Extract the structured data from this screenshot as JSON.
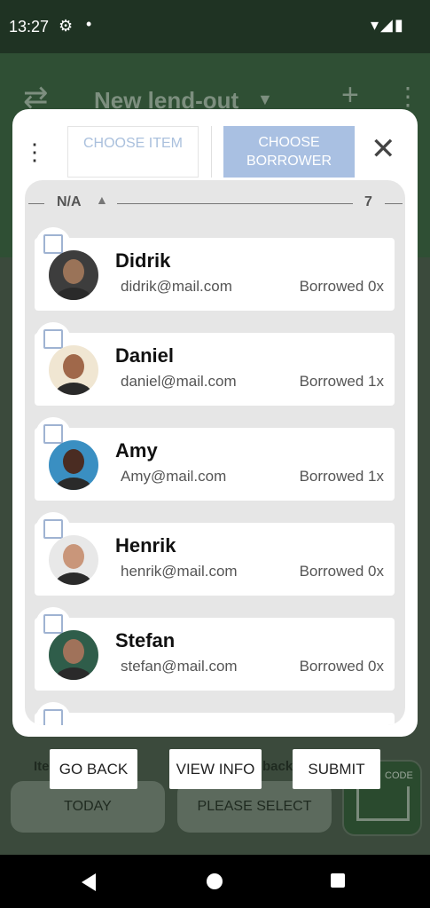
{
  "status": {
    "time": "13:27",
    "gear_icon": "⚙",
    "dot": "•",
    "sys_icons": "▾◢▮"
  },
  "appbar": {
    "title": "New lend-out",
    "dropdown_glyph": "▼",
    "add_glyph": "+",
    "more_glyph": "⋮",
    "logo_glyph": "⇄"
  },
  "underlying": {
    "item_label": "Ite",
    "feedback_label": "back",
    "today_button": "TODAY",
    "please_select_button": "PLEASE SELECT",
    "scan_code_label": "CODE"
  },
  "modal": {
    "menu_glyph": "⋮",
    "tab_choose_item": "CHOOSE ITEM",
    "tab_choose_borrower": "CHOOSE BORROWER",
    "close_glyph": "✕",
    "group": {
      "label": "N/A",
      "caret": "▲",
      "count": "7"
    },
    "borrowers": [
      {
        "name": "Didrik",
        "email": "didrik@mail.com",
        "borrowed": "Borrowed 0x",
        "avatar_bg": "#3d3d3d",
        "avatar_face": "#9a7358"
      },
      {
        "name": "Daniel",
        "email": "daniel@mail.com",
        "borrowed": "Borrowed 1x",
        "avatar_bg": "#f0e6d2",
        "avatar_face": "#a0684a"
      },
      {
        "name": "Amy",
        "email": "Amy@mail.com",
        "borrowed": "Borrowed 1x",
        "avatar_bg": "#3a8fc2",
        "avatar_face": "#4a2c22"
      },
      {
        "name": "Henrik",
        "email": "henrik@mail.com",
        "borrowed": "Borrowed 0x",
        "avatar_bg": "#e8e8e8",
        "avatar_face": "#c9967a"
      },
      {
        "name": "Stefan",
        "email": "stefan@mail.com",
        "borrowed": "Borrowed 0x",
        "avatar_bg": "#2f5d4a",
        "avatar_face": "#a0725a"
      }
    ]
  },
  "dialog_buttons": {
    "go_back": "GO BACK",
    "view_info": "VIEW INFO",
    "submit": "SUBMIT"
  },
  "colors": {
    "accent": "#a9c0e2",
    "checkbox": "#9fb3d2",
    "app_green": "#2f4f34"
  }
}
